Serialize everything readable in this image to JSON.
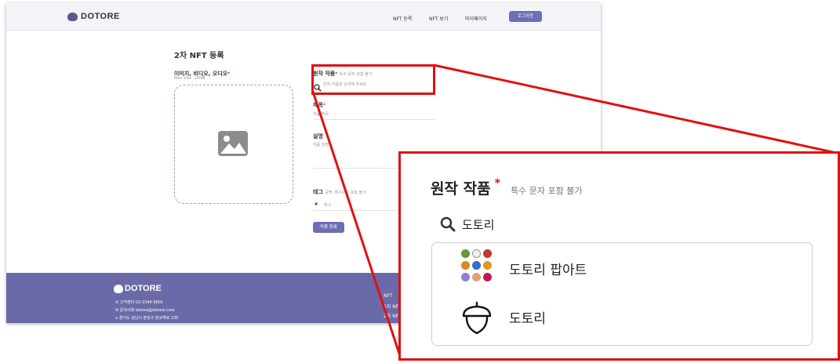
{
  "nav": {
    "brand": "DOTORE",
    "links": [
      "NFT 등록",
      "NFT 보기",
      "마이페이지"
    ],
    "logout": "로그아웃"
  },
  "form": {
    "title": "2차 NFT 등록",
    "media_label": "이미지, 비디오, 오디오",
    "media_sub": "Max Size: 10MB",
    "original_label": "원작 작품",
    "original_hint": "특수 문자 포함 불가",
    "original_placeholder": "원작 작품을 검색해 주세요",
    "name_label": "제목",
    "name_placeholder": "작품 제목",
    "desc_label": "설명",
    "desc_placeholder": "작품 설명",
    "tag_label": "태그",
    "tag_hint": "공백, 특수문자 포함 불가",
    "tag_prefix": "#",
    "tag_placeholder": "태그",
    "submit": "작품 등록",
    "required_mark": "*"
  },
  "footer": {
    "brand": "DOTORE",
    "phone": "고객센터 02-1544-9001",
    "email": "문의사항 dotore@dotore.com",
    "address": "경기도 성남시 분당구 판교역로 235",
    "links": [
      "NFT",
      "1차 NFT",
      "2차 NFT"
    ]
  },
  "zoom": {
    "label": "원작 작품",
    "required_mark": "*",
    "hint": "특수 문자 포함 불가",
    "query": "도토리",
    "results": [
      {
        "label": "도토리 팝아트",
        "icon": "acorn-grid-icon"
      },
      {
        "label": "도토리",
        "icon": "acorn-outline-icon"
      }
    ]
  },
  "colors": {
    "accent": "#6c6fb5",
    "footer": "#6a6aa8",
    "highlight": "#e01010",
    "required": "#e53030"
  }
}
